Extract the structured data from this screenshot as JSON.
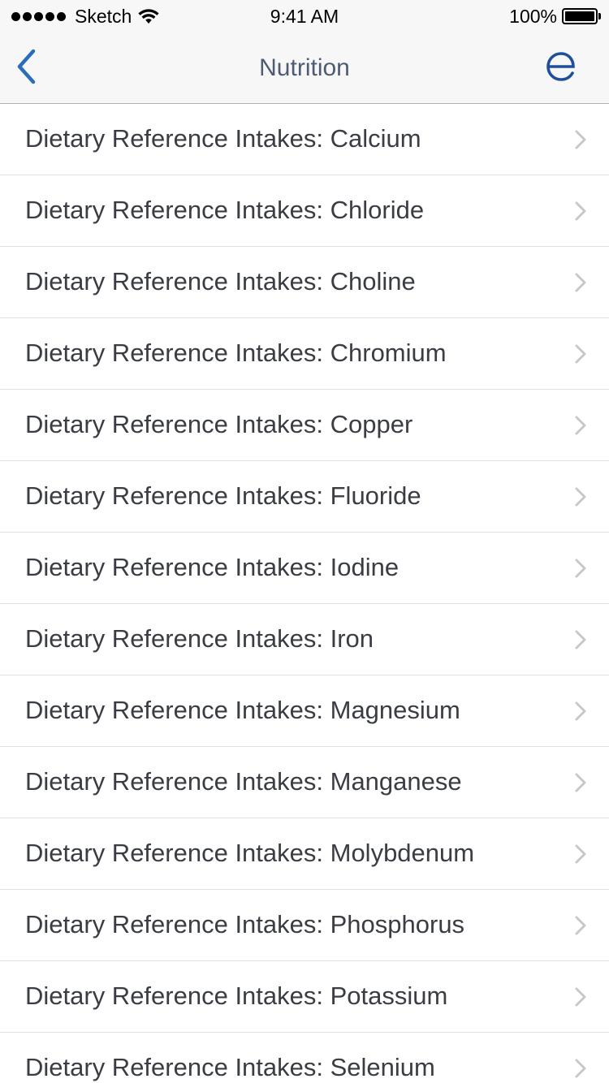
{
  "status_bar": {
    "carrier": "Sketch",
    "time": "9:41 AM",
    "battery": "100%",
    "signal_icon": "signal-dots-icon",
    "wifi_icon": "wifi-icon",
    "battery_icon": "battery-icon"
  },
  "nav": {
    "title": "Nutrition",
    "back_icon": "chevron-left-icon",
    "brand_icon": "epocrates-logo-icon",
    "accent_color": "#2a6ebb"
  },
  "list": {
    "items": [
      {
        "label": "Dietary Reference Intakes: Calcium"
      },
      {
        "label": "Dietary Reference Intakes: Chloride"
      },
      {
        "label": "Dietary Reference Intakes: Choline"
      },
      {
        "label": "Dietary Reference Intakes: Chromium"
      },
      {
        "label": "Dietary Reference Intakes: Copper"
      },
      {
        "label": "Dietary Reference Intakes: Fluoride"
      },
      {
        "label": "Dietary Reference Intakes: Iodine"
      },
      {
        "label": "Dietary Reference Intakes: Iron"
      },
      {
        "label": "Dietary Reference Intakes: Magnesium"
      },
      {
        "label": "Dietary Reference Intakes: Manganese"
      },
      {
        "label": "Dietary Reference Intakes: Molybdenum"
      },
      {
        "label": "Dietary Reference Intakes: Phosphorus"
      },
      {
        "label": "Dietary Reference Intakes: Potassium"
      },
      {
        "label": "Dietary Reference Intakes: Selenium"
      }
    ],
    "chevron_icon": "chevron-right-icon"
  }
}
